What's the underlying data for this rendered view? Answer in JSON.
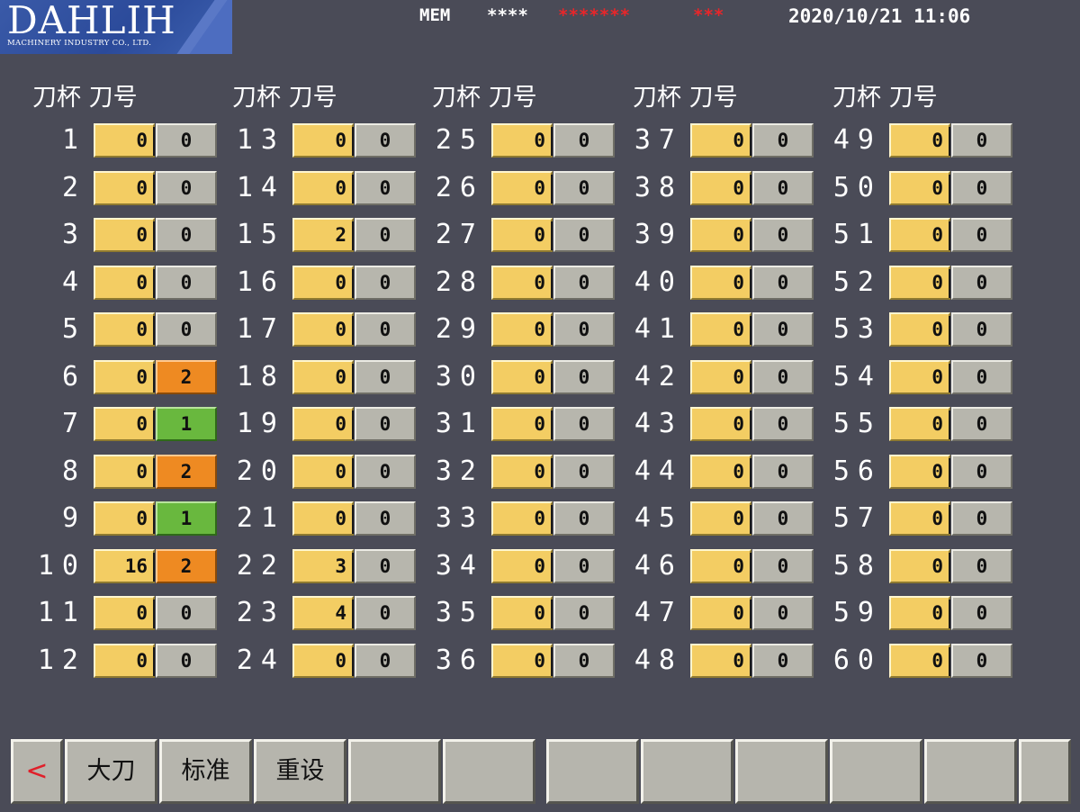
{
  "header": {
    "logo_name": "DAHLIH",
    "logo_subtitle": "MACHINERY INDUSTRY CO., LTD.",
    "mode": "MEM",
    "status_white": "****",
    "status_red_1": "*******",
    "status_red_2": "***",
    "datetime": "2020/10/21 11:06"
  },
  "column_header": "刀杯 刀号",
  "colors": {
    "background": "#4a4b57",
    "tool_box": "#f3cd63",
    "code_0": "#b7b6ad",
    "code_1": "#69b83e",
    "code_2": "#ee8a22",
    "status_red": "#e8262a"
  },
  "pots": [
    {
      "pot": "1",
      "tool": "0",
      "code": "0"
    },
    {
      "pot": "2",
      "tool": "0",
      "code": "0"
    },
    {
      "pot": "3",
      "tool": "0",
      "code": "0"
    },
    {
      "pot": "4",
      "tool": "0",
      "code": "0"
    },
    {
      "pot": "5",
      "tool": "0",
      "code": "0"
    },
    {
      "pot": "6",
      "tool": "0",
      "code": "2"
    },
    {
      "pot": "7",
      "tool": "0",
      "code": "1"
    },
    {
      "pot": "8",
      "tool": "0",
      "code": "2"
    },
    {
      "pot": "9",
      "tool": "0",
      "code": "1"
    },
    {
      "pot": "10",
      "tool": "16",
      "code": "2"
    },
    {
      "pot": "11",
      "tool": "0",
      "code": "0"
    },
    {
      "pot": "12",
      "tool": "0",
      "code": "0"
    },
    {
      "pot": "13",
      "tool": "0",
      "code": "0"
    },
    {
      "pot": "14",
      "tool": "0",
      "code": "0"
    },
    {
      "pot": "15",
      "tool": "2",
      "code": "0"
    },
    {
      "pot": "16",
      "tool": "0",
      "code": "0"
    },
    {
      "pot": "17",
      "tool": "0",
      "code": "0"
    },
    {
      "pot": "18",
      "tool": "0",
      "code": "0"
    },
    {
      "pot": "19",
      "tool": "0",
      "code": "0"
    },
    {
      "pot": "20",
      "tool": "0",
      "code": "0"
    },
    {
      "pot": "21",
      "tool": "0",
      "code": "0"
    },
    {
      "pot": "22",
      "tool": "3",
      "code": "0"
    },
    {
      "pot": "23",
      "tool": "4",
      "code": "0"
    },
    {
      "pot": "24",
      "tool": "0",
      "code": "0"
    },
    {
      "pot": "25",
      "tool": "0",
      "code": "0"
    },
    {
      "pot": "26",
      "tool": "0",
      "code": "0"
    },
    {
      "pot": "27",
      "tool": "0",
      "code": "0"
    },
    {
      "pot": "28",
      "tool": "0",
      "code": "0"
    },
    {
      "pot": "29",
      "tool": "0",
      "code": "0"
    },
    {
      "pot": "30",
      "tool": "0",
      "code": "0"
    },
    {
      "pot": "31",
      "tool": "0",
      "code": "0"
    },
    {
      "pot": "32",
      "tool": "0",
      "code": "0"
    },
    {
      "pot": "33",
      "tool": "0",
      "code": "0"
    },
    {
      "pot": "34",
      "tool": "0",
      "code": "0"
    },
    {
      "pot": "35",
      "tool": "0",
      "code": "0"
    },
    {
      "pot": "36",
      "tool": "0",
      "code": "0"
    },
    {
      "pot": "37",
      "tool": "0",
      "code": "0"
    },
    {
      "pot": "38",
      "tool": "0",
      "code": "0"
    },
    {
      "pot": "39",
      "tool": "0",
      "code": "0"
    },
    {
      "pot": "40",
      "tool": "0",
      "code": "0"
    },
    {
      "pot": "41",
      "tool": "0",
      "code": "0"
    },
    {
      "pot": "42",
      "tool": "0",
      "code": "0"
    },
    {
      "pot": "43",
      "tool": "0",
      "code": "0"
    },
    {
      "pot": "44",
      "tool": "0",
      "code": "0"
    },
    {
      "pot": "45",
      "tool": "0",
      "code": "0"
    },
    {
      "pot": "46",
      "tool": "0",
      "code": "0"
    },
    {
      "pot": "47",
      "tool": "0",
      "code": "0"
    },
    {
      "pot": "48",
      "tool": "0",
      "code": "0"
    },
    {
      "pot": "49",
      "tool": "0",
      "code": "0"
    },
    {
      "pot": "50",
      "tool": "0",
      "code": "0"
    },
    {
      "pot": "51",
      "tool": "0",
      "code": "0"
    },
    {
      "pot": "52",
      "tool": "0",
      "code": "0"
    },
    {
      "pot": "53",
      "tool": "0",
      "code": "0"
    },
    {
      "pot": "54",
      "tool": "0",
      "code": "0"
    },
    {
      "pot": "55",
      "tool": "0",
      "code": "0"
    },
    {
      "pot": "56",
      "tool": "0",
      "code": "0"
    },
    {
      "pot": "57",
      "tool": "0",
      "code": "0"
    },
    {
      "pot": "58",
      "tool": "0",
      "code": "0"
    },
    {
      "pot": "59",
      "tool": "0",
      "code": "0"
    },
    {
      "pot": "60",
      "tool": "0",
      "code": "0"
    }
  ],
  "softkeys": {
    "back": "<",
    "big_tool": "大刀",
    "standard": "标准",
    "reset": "重设"
  }
}
